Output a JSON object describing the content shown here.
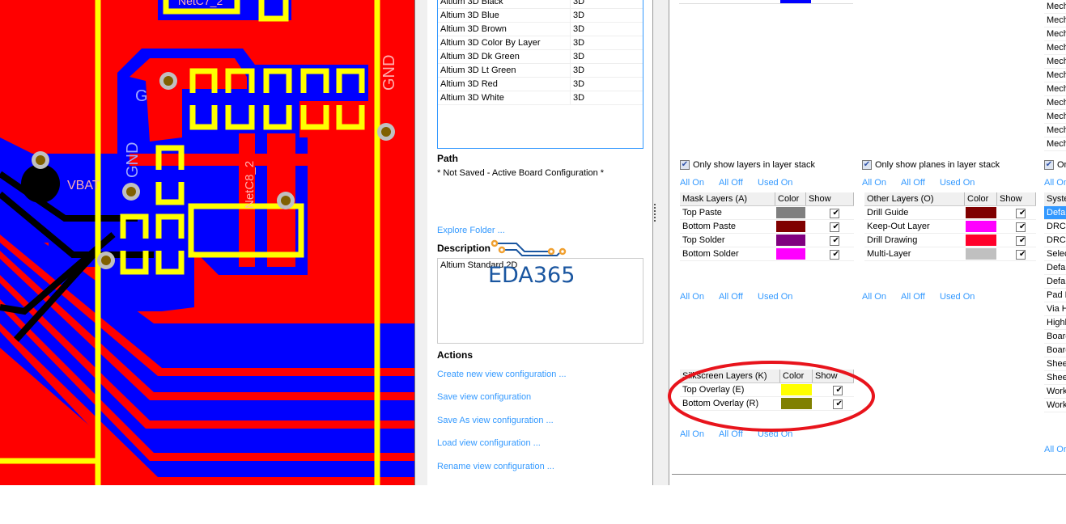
{
  "pcb": {
    "labels": {
      "netc7": "NetC7_2",
      "gnd_right": "GND",
      "gnd_left": "GND",
      "g_partial": "G",
      "vbat": "VBAT",
      "netc8": "NetC8_2"
    },
    "colors": {
      "top_layer": "#ff0000",
      "bottom_layer": "#0000ff",
      "overlay": "#ffff00",
      "via": "#c0c0c0",
      "hole": "#806000"
    }
  },
  "config_list": {
    "rows": [
      {
        "name": "Altium 3D Black",
        "type": "3D"
      },
      {
        "name": "Altium 3D Blue",
        "type": "3D"
      },
      {
        "name": "Altium 3D Brown",
        "type": "3D"
      },
      {
        "name": "Altium 3D Color By Layer",
        "type": "3D"
      },
      {
        "name": "Altium 3D Dk Green",
        "type": "3D"
      },
      {
        "name": "Altium 3D Lt Green",
        "type": "3D"
      },
      {
        "name": "Altium 3D Red",
        "type": "3D"
      },
      {
        "name": "Altium 3D White",
        "type": "3D"
      }
    ]
  },
  "path": {
    "heading": "Path",
    "value": "* Not Saved - Active Board Configuration *",
    "explore": "Explore Folder ..."
  },
  "description": {
    "heading": "Description",
    "value": "Altium Standard 2D"
  },
  "watermark": {
    "text": "EDA365"
  },
  "actions": {
    "heading": "Actions",
    "items": [
      "Create new view configuration ...",
      "Save view configuration",
      "Save As view configuration ...",
      "Load view configuration ...",
      "Rename view configuration ..."
    ]
  },
  "toggle_links": {
    "all_on": "All On",
    "all_off": "All Off",
    "used_on": "Used On"
  },
  "top_partial": {
    "color": "#0000ff"
  },
  "mask": {
    "checkbox": "Only show layers in layer stack",
    "headers": [
      "Mask Layers (A)",
      "Color",
      "Show"
    ],
    "rows": [
      {
        "name": "Top Paste",
        "color": "#808080",
        "show": true
      },
      {
        "name": "Bottom Paste",
        "color": "#800000",
        "show": true
      },
      {
        "name": "Top Solder",
        "color": "#800080",
        "show": true
      },
      {
        "name": "Bottom Solder",
        "color": "#ff00ff",
        "show": true
      }
    ]
  },
  "other": {
    "checkbox": "Only show planes in layer stack",
    "headers": [
      "Other Layers (O)",
      "Color",
      "Show"
    ],
    "rows": [
      {
        "name": "Drill Guide",
        "color": "#800000",
        "show": true
      },
      {
        "name": "Keep-Out Layer",
        "color": "#ff00ff",
        "show": true
      },
      {
        "name": "Drill Drawing",
        "color": "#ff002a",
        "show": true
      },
      {
        "name": "Multi-Layer",
        "color": "#c0c0c0",
        "show": true
      }
    ]
  },
  "silk": {
    "headers": [
      "Silkscreen Layers (K)",
      "Color",
      "Show"
    ],
    "rows": [
      {
        "name": "Top Overlay (E)",
        "color": "#ffff00",
        "show": true
      },
      {
        "name": "Bottom Overlay (R)",
        "color": "#808000",
        "show": true
      }
    ]
  },
  "mech": {
    "rows": [
      "Mech",
      "Mech",
      "Mech",
      "Mech",
      "Mech",
      "Mech",
      "Mech",
      "Mech",
      "Mech",
      "Mech",
      "Mech"
    ]
  },
  "system": {
    "checkbox": "On",
    "all_on": "All On",
    "header": "Syste",
    "rows": [
      "Defa",
      "DRC",
      "DRC",
      "Selec",
      "Defa",
      "Defa",
      "Pad H",
      "Via H",
      "Highl",
      "Board",
      "Board",
      "Shee",
      "Shee",
      "Work",
      "Work"
    ]
  },
  "annotation": {
    "color": "#e8141c"
  }
}
